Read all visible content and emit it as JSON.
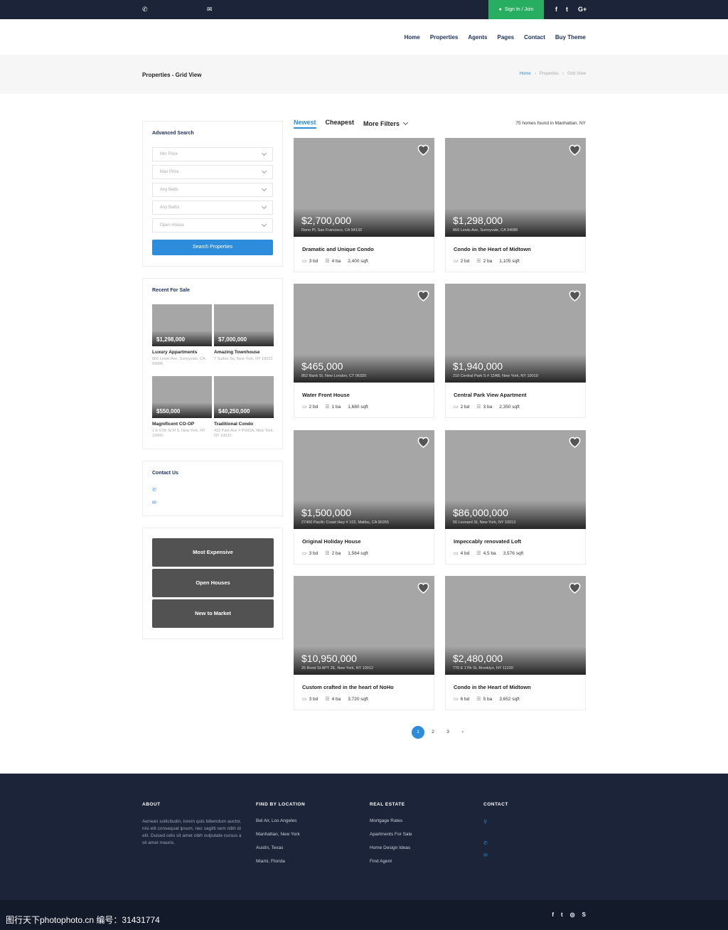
{
  "topbar": {
    "signin_label": "Sign In / Join",
    "phone_icon": "phone-icon",
    "email_icon": "envelope-icon",
    "social": [
      "f",
      "t",
      "G+"
    ]
  },
  "nav": {
    "items": [
      "Home",
      "Properties",
      "Agents",
      "Pages",
      "Contact",
      "Buy Theme"
    ]
  },
  "page": {
    "title": "Properties - Grid View",
    "breadcrumb": [
      "Home",
      "Properties",
      "Grid View"
    ]
  },
  "search": {
    "heading": "Advanced Search",
    "fields": [
      "Min Price",
      "Max Price",
      "Any Beds",
      "Any Baths",
      "Open House"
    ],
    "button": "Search Properties"
  },
  "recent": {
    "heading": "Recent For Sale",
    "items": [
      {
        "price": "$1,298,000",
        "name": "Luxury Appartments",
        "addr": "866 Lewis Ave, Sunnyvale, CA 94086"
      },
      {
        "price": "$7,000,000",
        "name": "Amazing Townhouse",
        "addr": "7 Sutton Sq, New York, NY 10022"
      },
      {
        "price": "$550,000",
        "name": "Magnificent CO-OP",
        "addr": "2 E 67th St Fl 5, New York, NY 10065"
      },
      {
        "price": "$40,250,000",
        "name": "Traditional Condo",
        "addr": "432 Park Ave # PH91A, New York, NY 10022"
      }
    ]
  },
  "contact_widget": {
    "heading": "Contact Us"
  },
  "quick_links": [
    "Most Expensive",
    "Open Houses",
    "New to Market"
  ],
  "filters": {
    "tabs": [
      "Newest",
      "Cheapest",
      "More Filters"
    ],
    "active": "Newest",
    "found": "75 homes found in Manhattan, NY"
  },
  "listings": [
    {
      "price": "$2,700,000",
      "addr": "Reno Pl, San Francisco, CA 94133",
      "name": "Dramatic and Unique Condo",
      "bd": "3 bd",
      "ba": "4 ba",
      "sqft": "2,400 sqft"
    },
    {
      "price": "$1,298,000",
      "addr": "866 Lewis Ave, Sunnyvale, CA 94086",
      "name": "Condo in the Heart of Midtown",
      "bd": "2 bd",
      "ba": "2 ba",
      "sqft": "1,105 sqft"
    },
    {
      "price": "$465,000",
      "addr": "852 Bank St, New London, CT 06320",
      "name": "Water Front House",
      "bd": "2 bd",
      "ba": "1 ba",
      "sqft": "1,680 sqft"
    },
    {
      "price": "$1,940,000",
      "addr": "210 Central Park S # 12AB, New York, NY 10019",
      "name": "Central Park View Apartment",
      "bd": "2 bd",
      "ba": "3 ba",
      "sqft": "2,350 sqft"
    },
    {
      "price": "$1,500,000",
      "addr": "27400 Pacific Coast Hwy # 102, Malibu, CA 90265",
      "name": "Original Holiday House",
      "bd": "3 bd",
      "ba": "2 ba",
      "sqft": "1,564 sqft"
    },
    {
      "price": "$86,000,000",
      "addr": "56 Leonard St, New York, NY 10013",
      "name": "Impeccably renovated Loft",
      "bd": "4 bd",
      "ba": "4,5 ba",
      "sqft": "3,576 sqft"
    },
    {
      "price": "$10,950,000",
      "addr": "25 Bond St APT 2E, New York, NY 10012",
      "name": "Custom crafted in the heart of NoHo",
      "bd": "3 bd",
      "ba": "4 ba",
      "sqft": "3,720 sqft"
    },
    {
      "price": "$2,480,000",
      "addr": "776 E 17th St, Brooklyn, NY 11230",
      "name": "Condo in the Heart of Midtown",
      "bd": "6 bd",
      "ba": "5 ba",
      "sqft": "3,652 sqft"
    }
  ],
  "pagination": {
    "pages": [
      "1",
      "2",
      "3"
    ],
    "current": "1",
    "next": "›"
  },
  "footer": {
    "about": {
      "heading": "ABOUT",
      "text": "Aenean sollicitudin, lorem quis bibendum auctor, nisi elit consequat ipsum, nec sagitti sem nibh id elit. Duised odio sit amet nibh vulputate cursus a sit amet mauris."
    },
    "location": {
      "heading": "FIND BY LOCATION",
      "items": [
        "Bel Air, Los Angeles",
        "Manhattan, New York",
        "Austin, Texas",
        "Miami, Florida"
      ]
    },
    "real_estate": {
      "heading": "REAL ESTATE",
      "items": [
        "Mortgage Rates",
        "Apartments For Sale",
        "Home Design Ideas",
        "Find Agent"
      ]
    },
    "contact": {
      "heading": "CONTACT"
    }
  },
  "bottombar": {
    "social": [
      "f",
      "t",
      "◎",
      "S"
    ]
  },
  "watermark": "图行天下photophoto.cn 编号：31431774",
  "colors": {
    "navy": "#1b2438",
    "accent": "#2d8cdb",
    "signin_green": "#27ae60",
    "placeholder_gray": "#a6a6a6"
  }
}
